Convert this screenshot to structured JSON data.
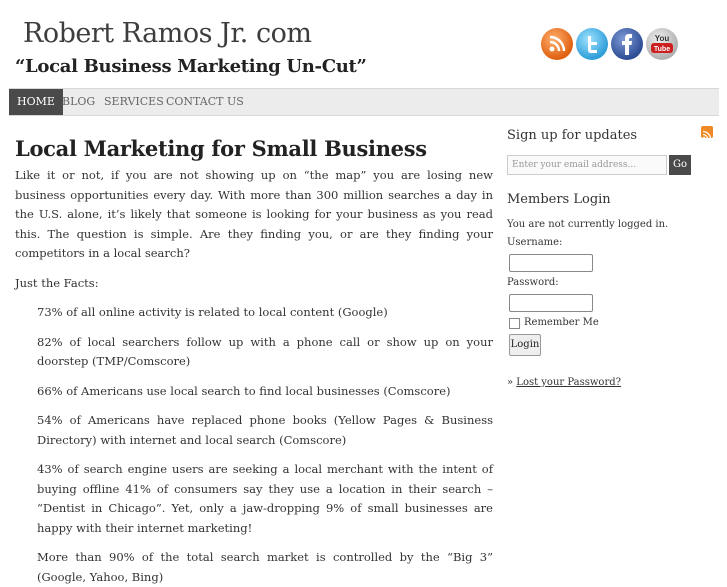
{
  "header": {
    "site_title": "Robert Ramos Jr. com",
    "tagline": "“Local Business Marketing Un-Cut”",
    "youtube_label_top": "You",
    "youtube_label_bottom": "Tube"
  },
  "nav": {
    "items": [
      "HOME",
      "BLOG",
      "SERVICES",
      "CONTACT US"
    ]
  },
  "post": {
    "title": "Local Marketing for Small Business",
    "intro": "Like it or not, if you are not showing up on “the map” you are losing new business opportunities every day. With more than 300 million searches a day in the U.S. alone, it’s likely that someone is looking for your business as you read this. The question is simple. Are they finding you, or are they finding your competitors in a local search?",
    "facts_heading": "Just the Facts:",
    "facts": [
      "73% of all online activity is related to local content (Google)",
      "82% of local searchers follow up with a phone call or show up on your doorstep (TMP/Comscore)",
      "66% of Americans use local search to find local businesses (Comscore)",
      "54% of Americans have replaced phone books (Yellow Pages & Business Directory) with internet and local search (Comscore)",
      "43% of search engine users are seeking a local merchant with the intent of buying offline 41% of consumers say they use a location in their search – “Dentist in Chicago”. Yet, only a jaw-dropping 9% of small businesses are happy with their internet marketing!",
      "More than 90% of the total search market is controlled by the “Big 3” (Google, Yahoo, Bing)"
    ]
  },
  "sidebar": {
    "signup_title": "Sign up for updates",
    "email_placeholder": "Enter your email address...",
    "go_label": "Go",
    "login_title": "Members Login",
    "login_status": "You are not currently logged in.",
    "username_label": "Username:",
    "password_label": "Password:",
    "remember_label": "Remember Me",
    "login_button": "Login",
    "lost_prefix": "» ",
    "lost_link": "Lost your Password?"
  },
  "colors": {
    "nav_active_bg": "#4a4a4a",
    "nav_bg": "#ececec"
  }
}
